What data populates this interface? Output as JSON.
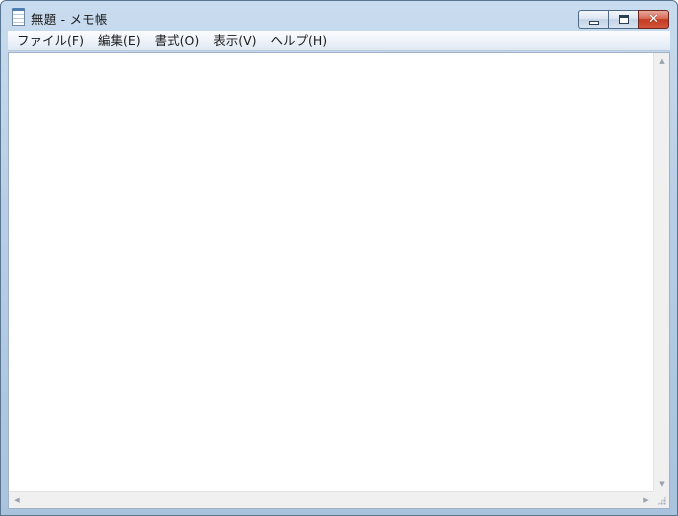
{
  "window": {
    "title": "無題 - メモ帳",
    "icon": "notepad-icon",
    "buttons": {
      "minimize_icon": "minimize-icon",
      "maximize_icon": "maximize-icon",
      "close_icon": "close-icon",
      "close_glyph": "✕"
    }
  },
  "menu": {
    "items": [
      {
        "label": "ファイル(F)"
      },
      {
        "label": "編集(E)"
      },
      {
        "label": "書式(O)"
      },
      {
        "label": "表示(V)"
      },
      {
        "label": "ヘルプ(H)"
      }
    ]
  },
  "editor": {
    "content": ""
  },
  "scrollbars": {
    "up_glyph": "▲",
    "down_glyph": "▼",
    "left_glyph": "◀",
    "right_glyph": "▶"
  }
}
